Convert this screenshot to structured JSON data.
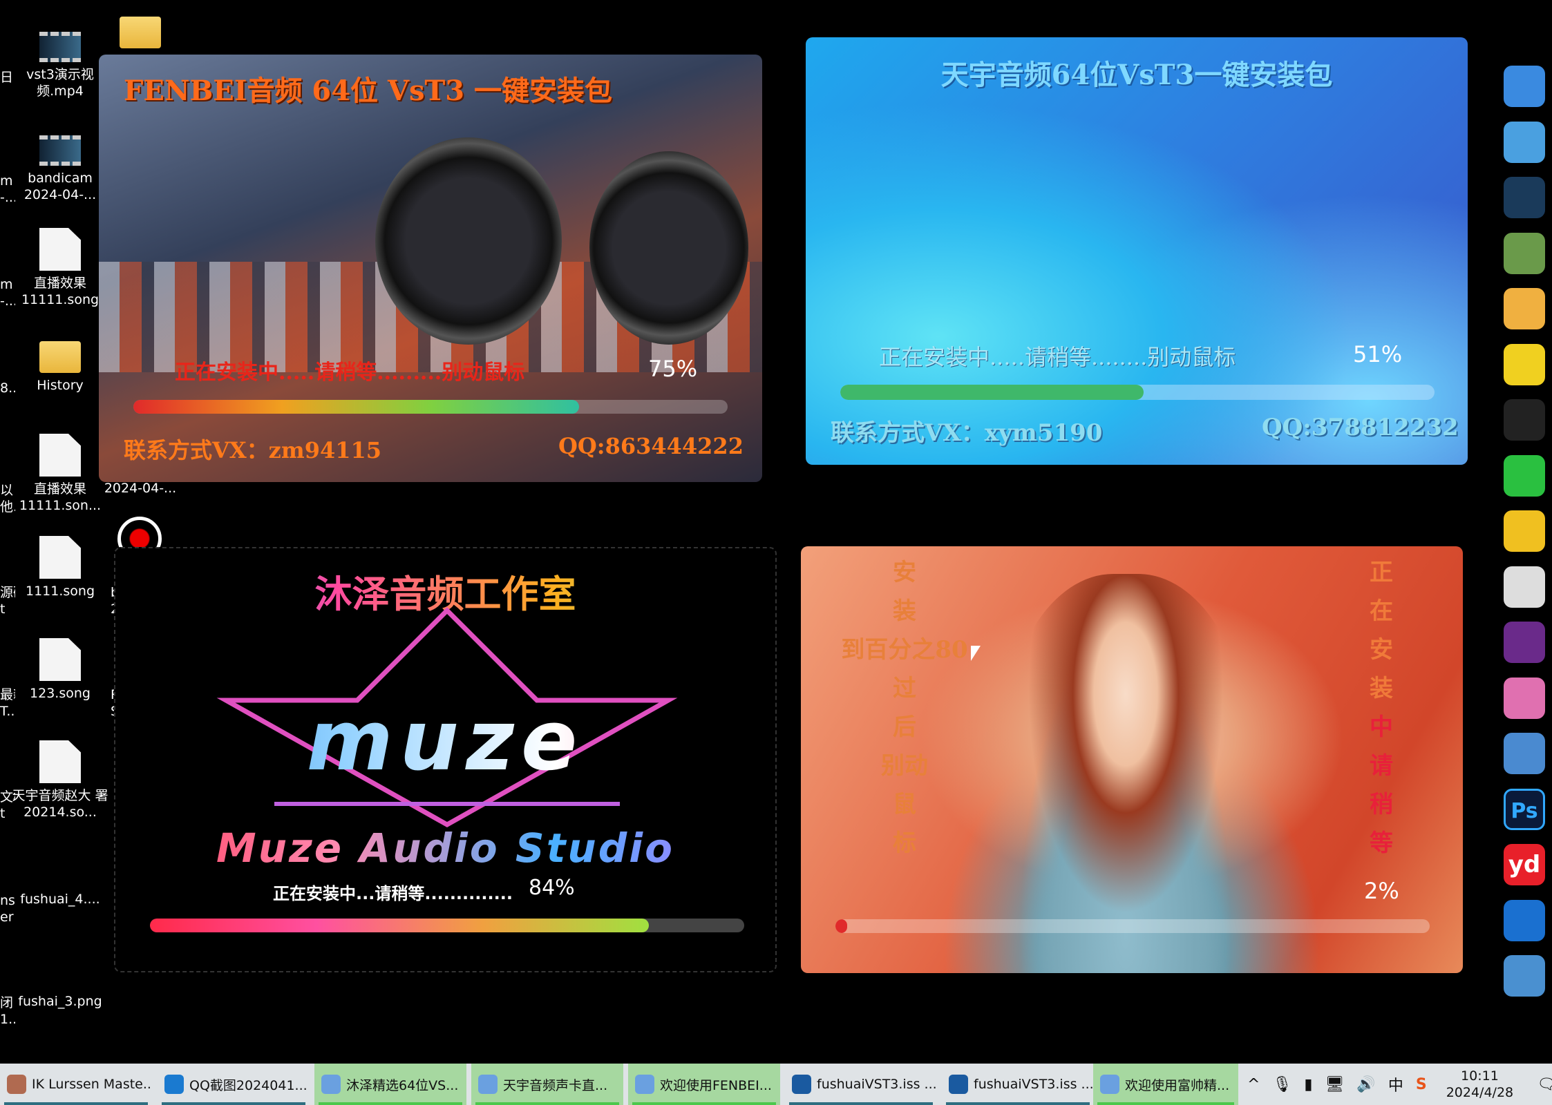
{
  "desktop": {
    "partial_labels": [
      "日",
      "m\n-...",
      "m\n-...",
      "8...",
      "以\n他...",
      "源码\nt",
      "最新\nT...",
      "文档\nt",
      "nse\ner",
      "闭\n1..."
    ],
    "icons": [
      {
        "label": "vst3演示视频.mp4",
        "type": "video"
      },
      {
        "label": "bandicam 2024-04-...",
        "type": "video"
      },
      {
        "label": "直播效果 11111.song",
        "type": "file"
      },
      {
        "label": "History",
        "type": "folder"
      },
      {
        "label": "直播效果 11111.son...",
        "type": "file"
      },
      {
        "label": "1111.song",
        "type": "file"
      },
      {
        "label": "123.song",
        "type": "file"
      },
      {
        "label": "天宇音频赵大 署20214.so...",
        "type": "file"
      },
      {
        "label": "fushuai_4....",
        "type": "image"
      },
      {
        "label": "fushai_3.png",
        "type": "image"
      }
    ],
    "extra_labels": {
      "col3_row5": "2024-04-...",
      "col3_row6": "b\n2",
      "col3_row7": "R\nS"
    }
  },
  "installer_fenbei": {
    "title": "FENBEI音频  64位  VsT3  一键安装包",
    "status": "正在安装中.....请稍等.........别动鼠标",
    "percent_text": "75%",
    "progress": 75,
    "contact_vx": "联系方式VX：zm94115",
    "contact_qq": "QQ:863444222"
  },
  "installer_tianyu": {
    "title": "天宇音频64位VsT3一键安装包",
    "status": "正在安装中.....请稍等........别动鼠标",
    "percent_text": "51%",
    "progress": 51,
    "contact_vx": "联系方式VX：xym5190",
    "contact_qq": "QQ:378812232"
  },
  "installer_muze": {
    "title": "沐泽音频工作室",
    "logo": "muze",
    "subtitle": "Muze Audio Studio",
    "status": "正在安装中...请稍等..............",
    "percent_text": "84%",
    "progress": 84
  },
  "installer_fushuai": {
    "left_column": [
      "安",
      "装",
      "到百分之80",
      "过",
      "后",
      "别动",
      "鼠",
      "标"
    ],
    "right_column": [
      "正",
      "在",
      "安",
      "装",
      "中",
      "请",
      "稍",
      "等"
    ],
    "percent_text": "2%",
    "progress": 2
  },
  "taskbar": {
    "items": [
      {
        "label": "IK Lurssen Maste...",
        "icon": "app-avatar-icon",
        "active": false
      },
      {
        "label": "QQ截图2024041...",
        "icon": "image-viewer-icon",
        "active": false
      },
      {
        "label": "沐泽精选64位VS...",
        "icon": "installer-icon",
        "active": true
      },
      {
        "label": "天宇音频声卡直...",
        "icon": "installer-icon",
        "active": true
      },
      {
        "label": "欢迎使用FENBEI...",
        "icon": "installer-icon",
        "active": true
      },
      {
        "label": "fushuaiVST3.iss ...",
        "icon": "inno-setup-icon",
        "active": false
      },
      {
        "label": "fushuaiVST3.iss ...",
        "icon": "inno-setup-icon",
        "active": false
      },
      {
        "label": "欢迎使用富帅精...",
        "icon": "installer-icon",
        "active": true
      }
    ],
    "tray": {
      "ime": "中",
      "time": "10:11",
      "date": "2024/4/28"
    }
  },
  "right_icons": [
    "windows-flag-icon",
    "network-computer-icon",
    "app-icon",
    "paint-icon",
    "avatar-icon",
    "qq-music-icon",
    "qq-penguin-icon",
    "wechat-icon",
    "fish-icon",
    "scissors-icon",
    "microphone-icon",
    "camera-icon",
    "search-magnifier-icon",
    "photoshop-icon",
    "youdao-icon",
    "internet-explorer-icon",
    "monitor-icon"
  ],
  "right_icon_text": {
    "photoshop": "Ps",
    "youdao": "yd"
  }
}
